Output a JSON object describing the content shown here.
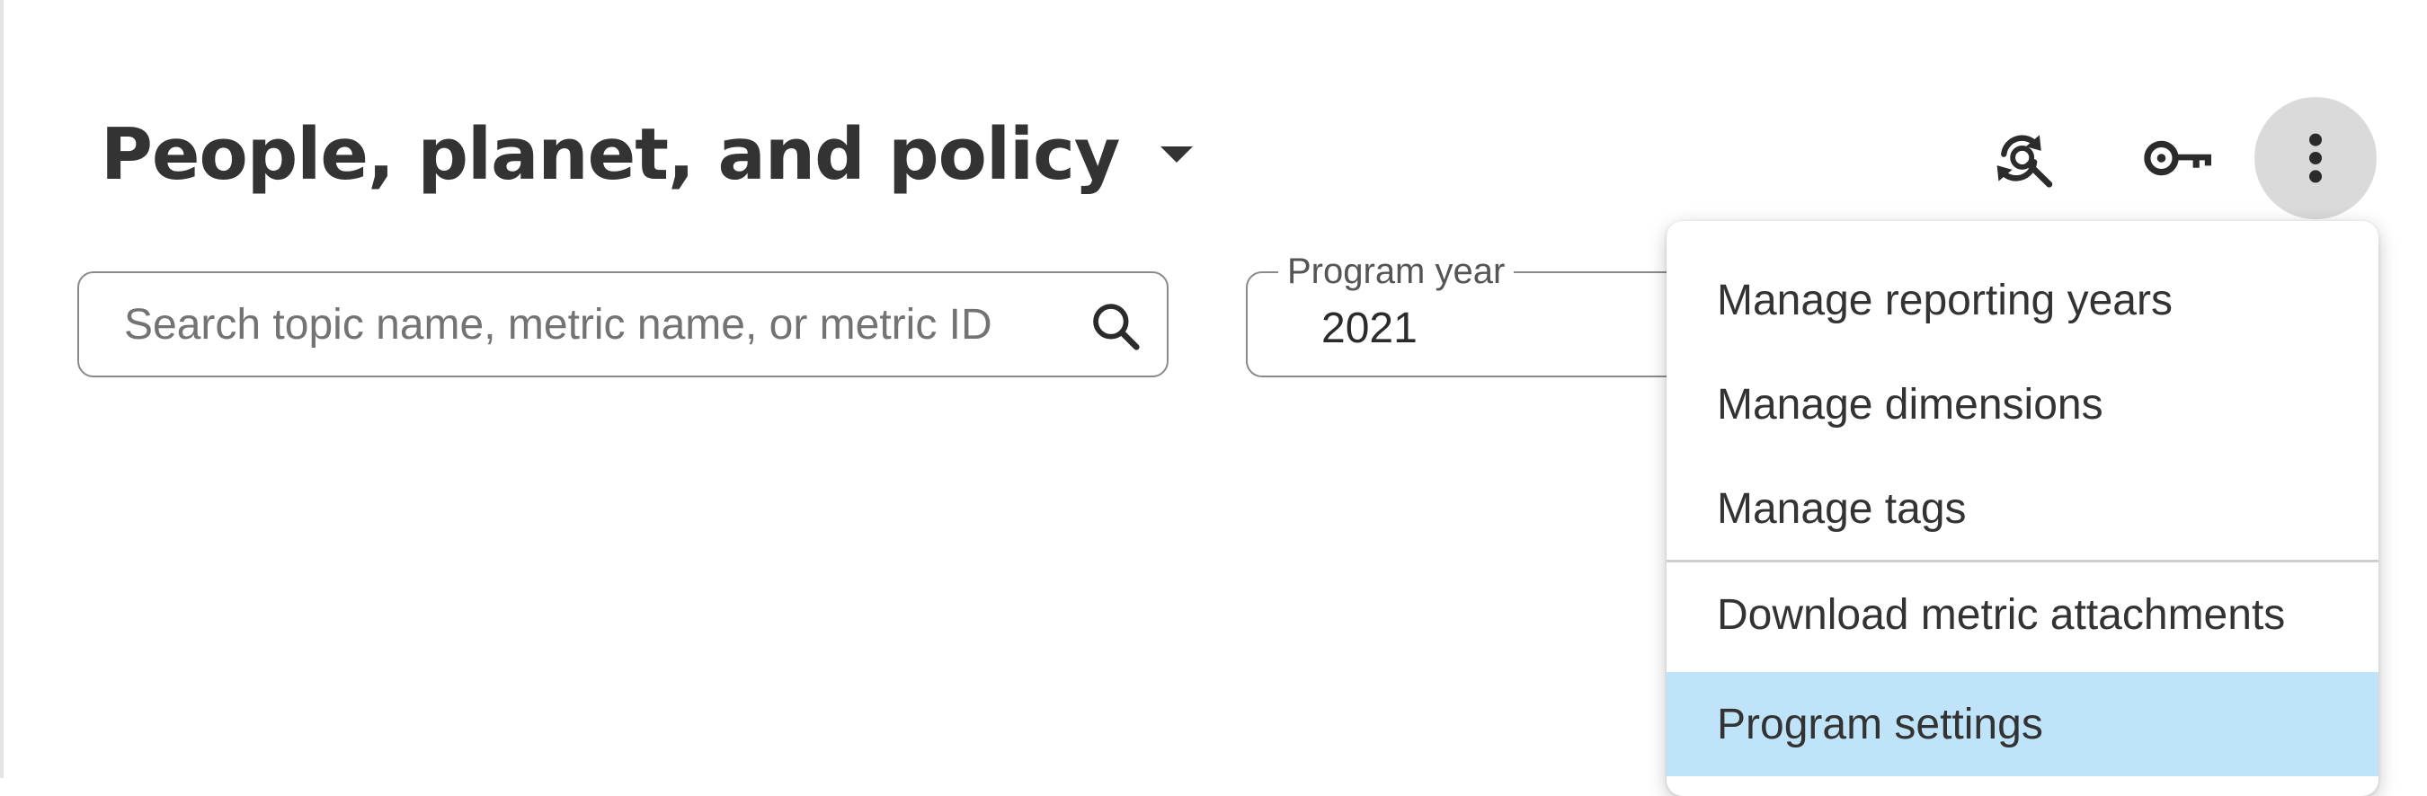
{
  "header": {
    "title": "People, planet, and policy"
  },
  "search": {
    "placeholder": "Search topic name, metric name, or metric ID"
  },
  "program_year": {
    "label": "Program year",
    "value": "2021"
  },
  "toolbar": {
    "icons": [
      "refresh-search-icon",
      "key-icon",
      "more-vertical-icon"
    ]
  },
  "menu": {
    "items": [
      {
        "label": "Manage reporting years"
      },
      {
        "label": "Manage dimensions"
      },
      {
        "label": "Manage tags"
      },
      {
        "label": "Download metric attachments"
      },
      {
        "label": "Program settings"
      }
    ]
  },
  "colors": {
    "highlight": "#bfe3f9",
    "more_button_bg": "#dadada",
    "text": "#333333"
  }
}
